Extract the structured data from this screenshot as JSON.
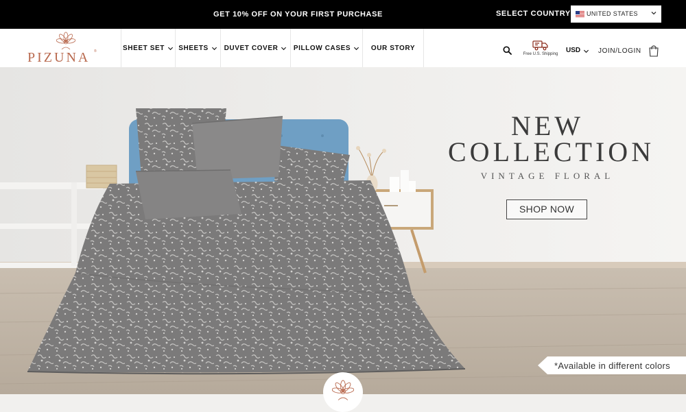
{
  "promo": {
    "text": "GET 10% OFF ON YOUR FIRST PURCHASE",
    "country_label": "SELECT COUNTRY",
    "country_value": "UNITED STATES",
    "flag_icon": "us-flag-icon"
  },
  "header": {
    "logo_text": "PIZUNA",
    "logo_mark": "®",
    "brand_color": "#b96a4f",
    "nav": [
      {
        "label": "SHEET SET",
        "dropdown": true
      },
      {
        "label": "SHEETS",
        "dropdown": true
      },
      {
        "label": "DUVET COVER",
        "dropdown": true
      },
      {
        "label": "PILLOW CASES",
        "dropdown": true
      },
      {
        "label": "OUR STORY",
        "dropdown": false
      }
    ],
    "search_icon": "search-icon",
    "shipping_icon": "truck-icon",
    "shipping_label": "Free U.S. Shipping",
    "currency": "USD",
    "login": "JOIN/LOGIN",
    "cart_icon": "shopping-bag-icon"
  },
  "hero": {
    "title_line1": "NEW",
    "title_line2": "COLLECTION",
    "subtitle": "VINTAGE FLORAL",
    "cta": "SHOP NOW",
    "tag": "*Available in different colors"
  },
  "colors": {
    "promo_bg": "#000000",
    "duvet": "#7b7a7a",
    "headboard": "#6f9fc4"
  }
}
